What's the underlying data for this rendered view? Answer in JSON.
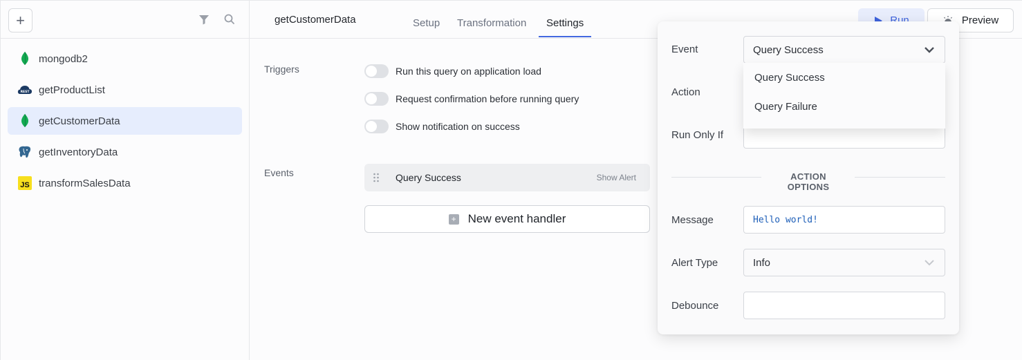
{
  "sidebar": {
    "add_label": "+",
    "filter_icon": "filter-icon",
    "search_icon": "search-icon",
    "queries": [
      {
        "name": "mongodb2",
        "icon": "mongodb-icon",
        "active": false
      },
      {
        "name": "getProductList",
        "icon": "rest-api-icon",
        "active": false
      },
      {
        "name": "getCustomerData",
        "icon": "mongodb-icon",
        "active": true
      },
      {
        "name": "getInventoryData",
        "icon": "postgresql-icon",
        "active": false
      },
      {
        "name": "transformSalesData",
        "icon": "javascript-icon",
        "badge": "JS",
        "active": false
      }
    ]
  },
  "header": {
    "query_name": "getCustomerData",
    "tabs": [
      {
        "label": "Setup",
        "active": false
      },
      {
        "label": "Transformation",
        "active": false
      },
      {
        "label": "Settings",
        "active": true
      }
    ],
    "run_label": "Run",
    "preview_label": "Preview"
  },
  "settings": {
    "triggers_label": "Triggers",
    "triggers": [
      {
        "label": "Run this query on application load",
        "enabled": false
      },
      {
        "label": "Request confirmation before running query",
        "enabled": false
      },
      {
        "label": "Show notification on success",
        "enabled": false
      }
    ],
    "events_label": "Events",
    "events": [
      {
        "event": "Query Success",
        "action": "Show Alert"
      }
    ],
    "new_handler_label": "New event handler"
  },
  "popover": {
    "event_label": "Event",
    "event_value": "Query Success",
    "event_options": [
      "Query Success",
      "Query Failure"
    ],
    "action_label": "Action",
    "run_only_if_label": "Run Only If",
    "run_only_if_value": "",
    "action_options_heading": "ACTION OPTIONS",
    "message_label": "Message",
    "message_value": "Hello world!",
    "alert_type_label": "Alert Type",
    "alert_type_value": "Info",
    "debounce_label": "Debounce",
    "debounce_value": ""
  },
  "colors": {
    "accent": "#4368e0",
    "active_item_bg": "#e6edfd",
    "mongodb_green": "#13aa52",
    "js_yellow": "#f7df1e"
  }
}
